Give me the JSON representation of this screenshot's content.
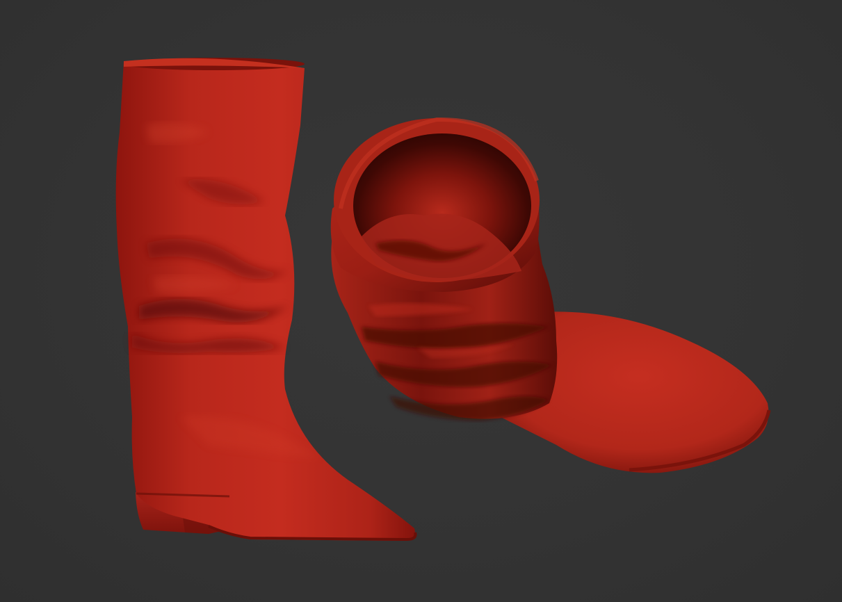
{
  "scene": {
    "background_color": "#333333",
    "material_color": "#b3241a",
    "objects": [
      {
        "name": "upright-boot",
        "description_icon": "boot-icon"
      },
      {
        "name": "tilted-boot",
        "description_icon": "boot-icon"
      }
    ]
  }
}
